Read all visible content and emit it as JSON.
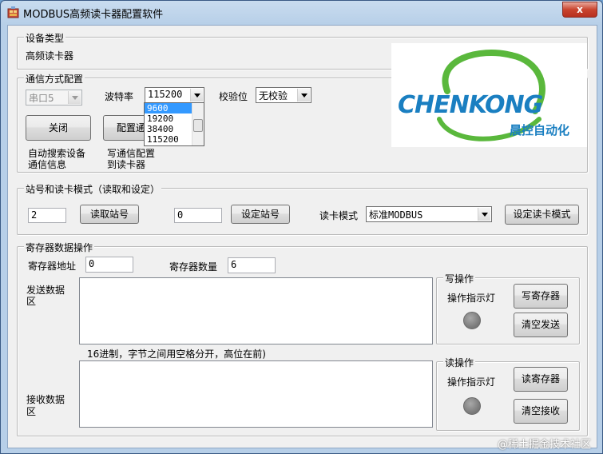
{
  "window": {
    "title": "MODBUS高频读卡器配置软件",
    "close_label": "x"
  },
  "device_type": {
    "legend": "设备类型",
    "value": "高频读卡器"
  },
  "comm": {
    "legend": "通信方式配置",
    "port_value": "串口5",
    "baud_label": "波特率",
    "baud_value": "115200",
    "baud_options": [
      "9600",
      "19200",
      "38400",
      "115200"
    ],
    "parity_label": "校验位",
    "parity_value": "无校验",
    "close_button": "关闭",
    "config_button": "配置通信",
    "auto_search_note_1": "自动搜索设备",
    "auto_search_note_2": "通信信息",
    "write_note_1": "写通信配置",
    "write_note_2": "到读卡器"
  },
  "logo": {
    "text": "CHENKONG",
    "subtext": "晨控自动化"
  },
  "station": {
    "legend": "站号和读卡模式（读取和设定）",
    "read_station_value": "2",
    "read_station_button": "读取站号",
    "set_station_value": "0",
    "set_station_button": "设定站号",
    "mode_label": "读卡模式",
    "mode_value": "标准MODBUS",
    "set_mode_button": "设定读卡模式"
  },
  "register": {
    "legend": "寄存器数据操作",
    "address_label": "寄存器地址",
    "address_value": "0",
    "count_label": "寄存器数量",
    "count_value": "6",
    "send_label_1": "发送数据",
    "send_label_2": "区",
    "hint": "16进制，字节之间用空格分开，高位在前)",
    "recv_label_1": "接收数据",
    "recv_label_2": "区"
  },
  "write_op": {
    "legend": "写操作",
    "indicator_label": "操作指示灯",
    "write_button": "写寄存器",
    "clear_button": "清空发送"
  },
  "read_op": {
    "legend": "读操作",
    "indicator_label": "操作指示灯",
    "read_button": "读寄存器",
    "clear_button": "清空接收"
  },
  "watermark": "@稀土掘金技术社区",
  "colors": {
    "logo_blue": "#1a7fc1",
    "logo_green": "#5ab83c",
    "selection": "#3399ff"
  }
}
